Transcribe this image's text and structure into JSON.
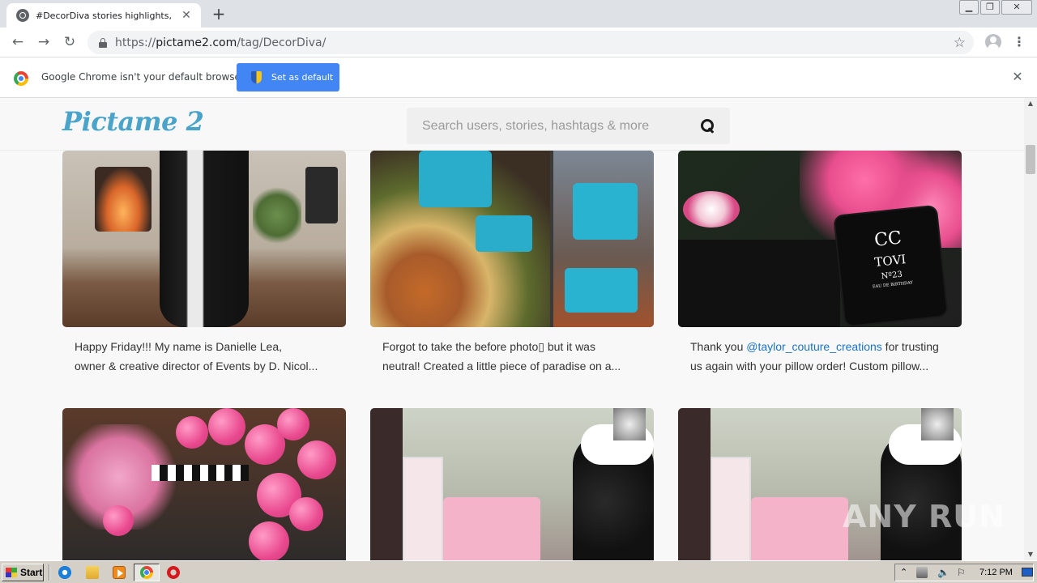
{
  "browser": {
    "tab_title": "#DecorDiva stories highlights, photos",
    "tab_close": "✕",
    "new_tab": "+",
    "url_scheme": "https://",
    "url_host": "pictame2.com",
    "url_path": "/tag/DecorDiva/",
    "back": "←",
    "forward": "→",
    "reload": "↻",
    "bookmark": "☆",
    "menu": "⋮",
    "window_minimize": "▁",
    "window_restore": "❐",
    "window_close": "✕"
  },
  "infobar": {
    "message": "Google Chrome isn't your default browser",
    "button_label": "Set as default",
    "close": "✕"
  },
  "site": {
    "logo": "Pictame 2",
    "search_placeholder": "Search users, stories, hashtags & more"
  },
  "posts": [
    {
      "caption_line1": "Happy Friday!!!       My name is Danielle Lea,",
      "caption_line2": "owner & creative director of Events by D. Nicol..."
    },
    {
      "caption_line1": "Forgot to take the before photo▯ but it was",
      "caption_line2": "neutral! Created a little piece of paradise on a..."
    },
    {
      "caption_prefix": "Thank you ",
      "caption_mention": "@taylor_couture_creations",
      "caption_suffix": " for trusting",
      "caption_line2": "us again with your pillow order! Custom pillow..."
    }
  ],
  "pillow_text": {
    "logo": "CC",
    "name": "TOVI",
    "number": "Nº23",
    "sub": "EAU DE BIRTHDAY"
  },
  "watermark": "ANY  RUN",
  "scrollbar": {
    "up": "▲",
    "down": "▼"
  },
  "taskbar": {
    "start_label": "Start",
    "clock": "7:12 PM",
    "tray_arrow": "⌃",
    "volume": "🔈",
    "flag": "⚐"
  }
}
